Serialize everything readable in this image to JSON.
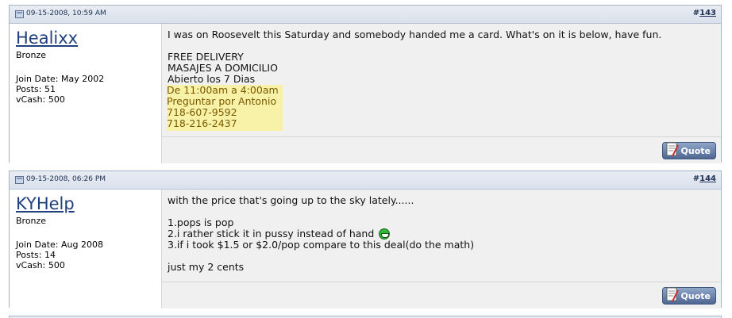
{
  "posts": [
    {
      "date": "09-15-2008, 10:59 AM",
      "number_prefix": "#",
      "number": "143",
      "user": {
        "name": "Healixx",
        "rank": "Bronze",
        "join_date": "Join Date: May 2002",
        "posts": "Posts: 51",
        "vcash": "vCash: 500"
      },
      "message": {
        "intro": "I was on Roosevelt this Saturday and somebody handed me a card. What's on it is below, have fun.",
        "lines": [
          "FREE DELIVERY",
          "MASAJES A DOMICILIO",
          "Abierto los 7 Dias"
        ],
        "highlighted_lines": [
          "De 11:00am a 4:00am",
          "Preguntar por Antonio",
          "718-607-9592",
          "718-216-2437"
        ]
      },
      "quote_label": "Quote"
    },
    {
      "date": "09-15-2008, 06:26 PM",
      "number_prefix": "#",
      "number": "144",
      "user": {
        "name": "KYHelp",
        "rank": "Bronze",
        "join_date": "Join Date: Aug 2008",
        "posts": "Posts: 14",
        "vcash": "vCash: 500"
      },
      "message": {
        "intro": "with the price that's going up to the sky lately......",
        "line1": "1.pops is pop",
        "line2": "2.i rather stick it in pussy instead of hand",
        "line3": "3.if i took $1.5 or $2.0/pop compare to this deal(do the math)",
        "closing": "just my 2 cents",
        "smiley_icon": "grin-smiley-icon"
      },
      "quote_label": "Quote"
    }
  ],
  "colors": {
    "header_bg": "#dce3ee",
    "username": "#1f3f7d",
    "message_bg": "#f0f0f0",
    "highlight_bg": "#f8f2a8",
    "highlight_text": "#7b5a00",
    "quote_button": "#4e6792"
  }
}
